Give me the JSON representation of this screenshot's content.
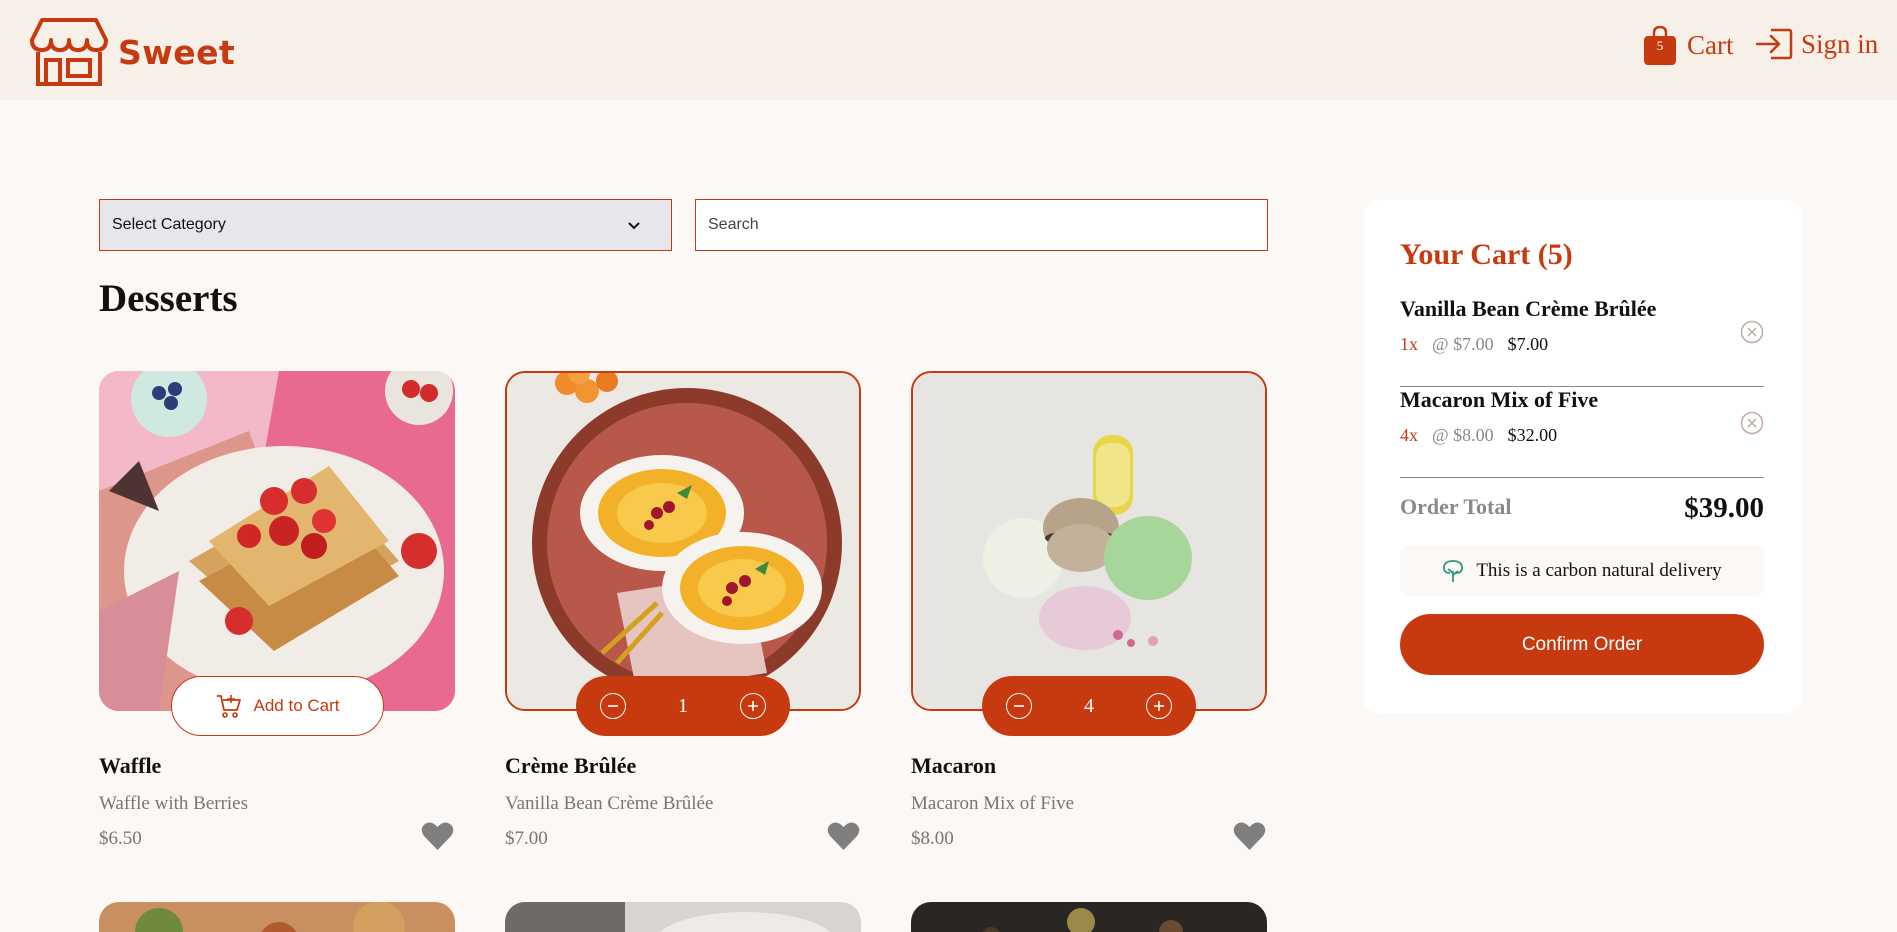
{
  "brand": {
    "name": "Sweet",
    "accent": "#c73a10"
  },
  "header": {
    "cart_label": "Cart",
    "cart_count": "5",
    "signin_label": "Sign in"
  },
  "filters": {
    "category_value": "Select Category",
    "search_placeholder": "Search"
  },
  "section_title": "Desserts",
  "products": [
    {
      "name": "Waffle",
      "description": "Waffle with Berries",
      "price": "$6.50",
      "action": "Add to Cart",
      "in_cart": false
    },
    {
      "name": "Crème Brûlée",
      "description": "Vanilla Bean Crème Brûlée",
      "price": "$7.00",
      "quantity": "1",
      "in_cart": true
    },
    {
      "name": "Macaron",
      "description": "Macaron Mix of Five",
      "price": "$8.00",
      "quantity": "4",
      "in_cart": true
    }
  ],
  "cart": {
    "title": "Your Cart (5)",
    "items": [
      {
        "name": "Vanilla Bean Crème Brûlée",
        "qty": "1x",
        "unit": "@ $7.00",
        "total": "$7.00"
      },
      {
        "name": "Macaron Mix of Five",
        "qty": "4x",
        "unit": "@ $8.00",
        "total": "$32.00"
      }
    ],
    "order_total_label": "Order Total",
    "order_total_value": "$39.00",
    "carbon_note": "This is a carbon natural delivery",
    "confirm_label": "Confirm Order"
  }
}
